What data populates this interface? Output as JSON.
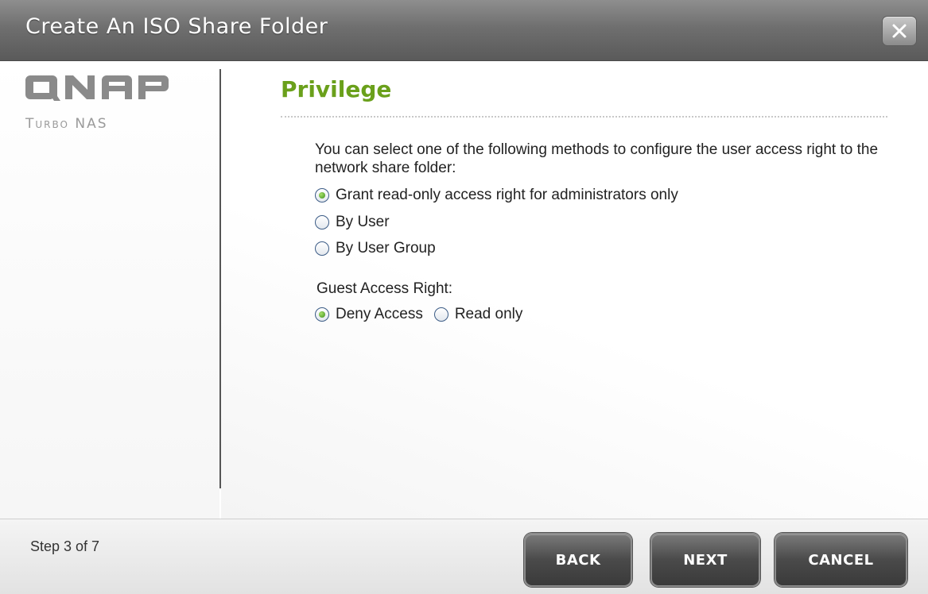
{
  "window": {
    "title": "Create An ISO Share Folder",
    "close_icon": "close-icon"
  },
  "brand": {
    "logo_text": "QNAP",
    "subtitle": "Turbo NAS"
  },
  "main": {
    "section_title": "Privilege",
    "description": "You can select one of the following methods to configure the user access right to the network share folder:",
    "access_options": [
      {
        "label": "Grant read-only access right for administrators only",
        "selected": true
      },
      {
        "label": "By User",
        "selected": false
      },
      {
        "label": "By User Group",
        "selected": false
      }
    ],
    "guest": {
      "label": "Guest Access Right:",
      "options": [
        {
          "label": "Deny Access",
          "selected": true
        },
        {
          "label": "Read only",
          "selected": false
        }
      ]
    }
  },
  "footer": {
    "step": "Step 3 of 7",
    "back_label": "BACK",
    "next_label": "NEXT",
    "cancel_label": "CANCEL"
  },
  "colors": {
    "title_green": "#6aa01b",
    "titlebar_gray": "#6f6f6f",
    "button_dark": "#4a4a4a"
  }
}
